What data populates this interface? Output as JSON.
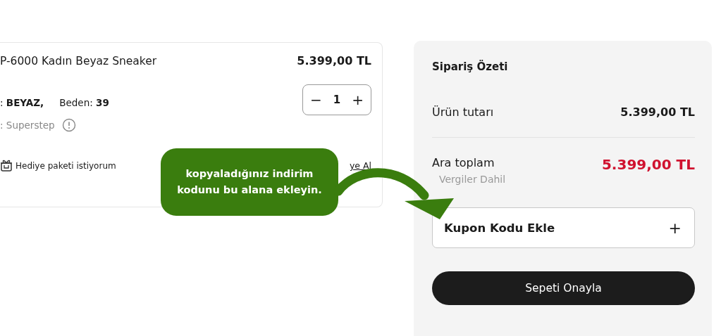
{
  "product": {
    "title": "P-6000 Kadın Beyaz Sneaker",
    "price": "5.399,00 TL",
    "color_label": ":",
    "color_value": "BEYAZ,",
    "size_label": "Beden:",
    "size_value": "39",
    "seller": ": Superstep",
    "gift_label": "Hediye paketi istiyorum",
    "link": "ye Al",
    "quantity": {
      "minus": "−",
      "value": "1",
      "plus": "+"
    }
  },
  "callout": {
    "text": "kopyaladığınız indirim kodunu bu alana ekleyin."
  },
  "summary": {
    "title": "Sipariş Özeti",
    "rows": [
      {
        "label": "Ürün tutarı",
        "value": "5.399,00 TL",
        "kind": "plain"
      },
      {
        "label": "Ara toplam",
        "value": "5.399,00 TL",
        "note": "Vergiler Dahil",
        "kind": "total"
      }
    ],
    "coupon": {
      "label": "Kupon Kodu Ekle",
      "icon": "+"
    },
    "confirm_button": "Sepeti Onayla"
  }
}
